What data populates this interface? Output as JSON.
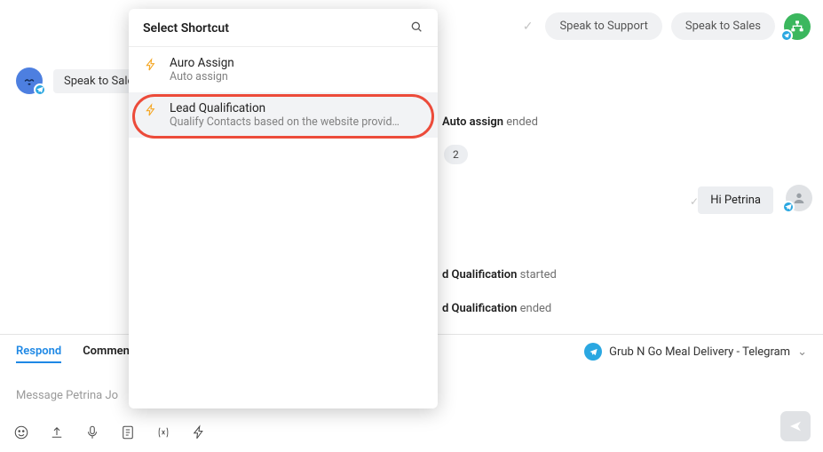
{
  "topbar": {
    "chip_support": "Speak to Support",
    "chip_sales": "Speak to Sales"
  },
  "left_chip": "Speak to Sale",
  "conversation": {
    "bg_assign_text_prefix": "Auto assign",
    "bg_assign_text_suffix": " ended",
    "badge_value": "2",
    "message_text": "Hi Petrina",
    "lq_started_prefix": "d Qualification",
    "lq_started_suffix": " started",
    "lq_ended_prefix": "d Qualification",
    "lq_ended_suffix": " ended"
  },
  "compose": {
    "tab_respond": "Respond",
    "tab_comment": "Comment",
    "channel_label": "Grub N Go Meal Delivery - Telegram",
    "placeholder": "Message Petrina Jo"
  },
  "popover": {
    "title": "Select Shortcut",
    "items": [
      {
        "title": "Auro Assign",
        "subtitle": "Auto assign"
      },
      {
        "title": "Lead Qualification",
        "subtitle": "Qualify Contacts based on the website provid…"
      }
    ]
  }
}
